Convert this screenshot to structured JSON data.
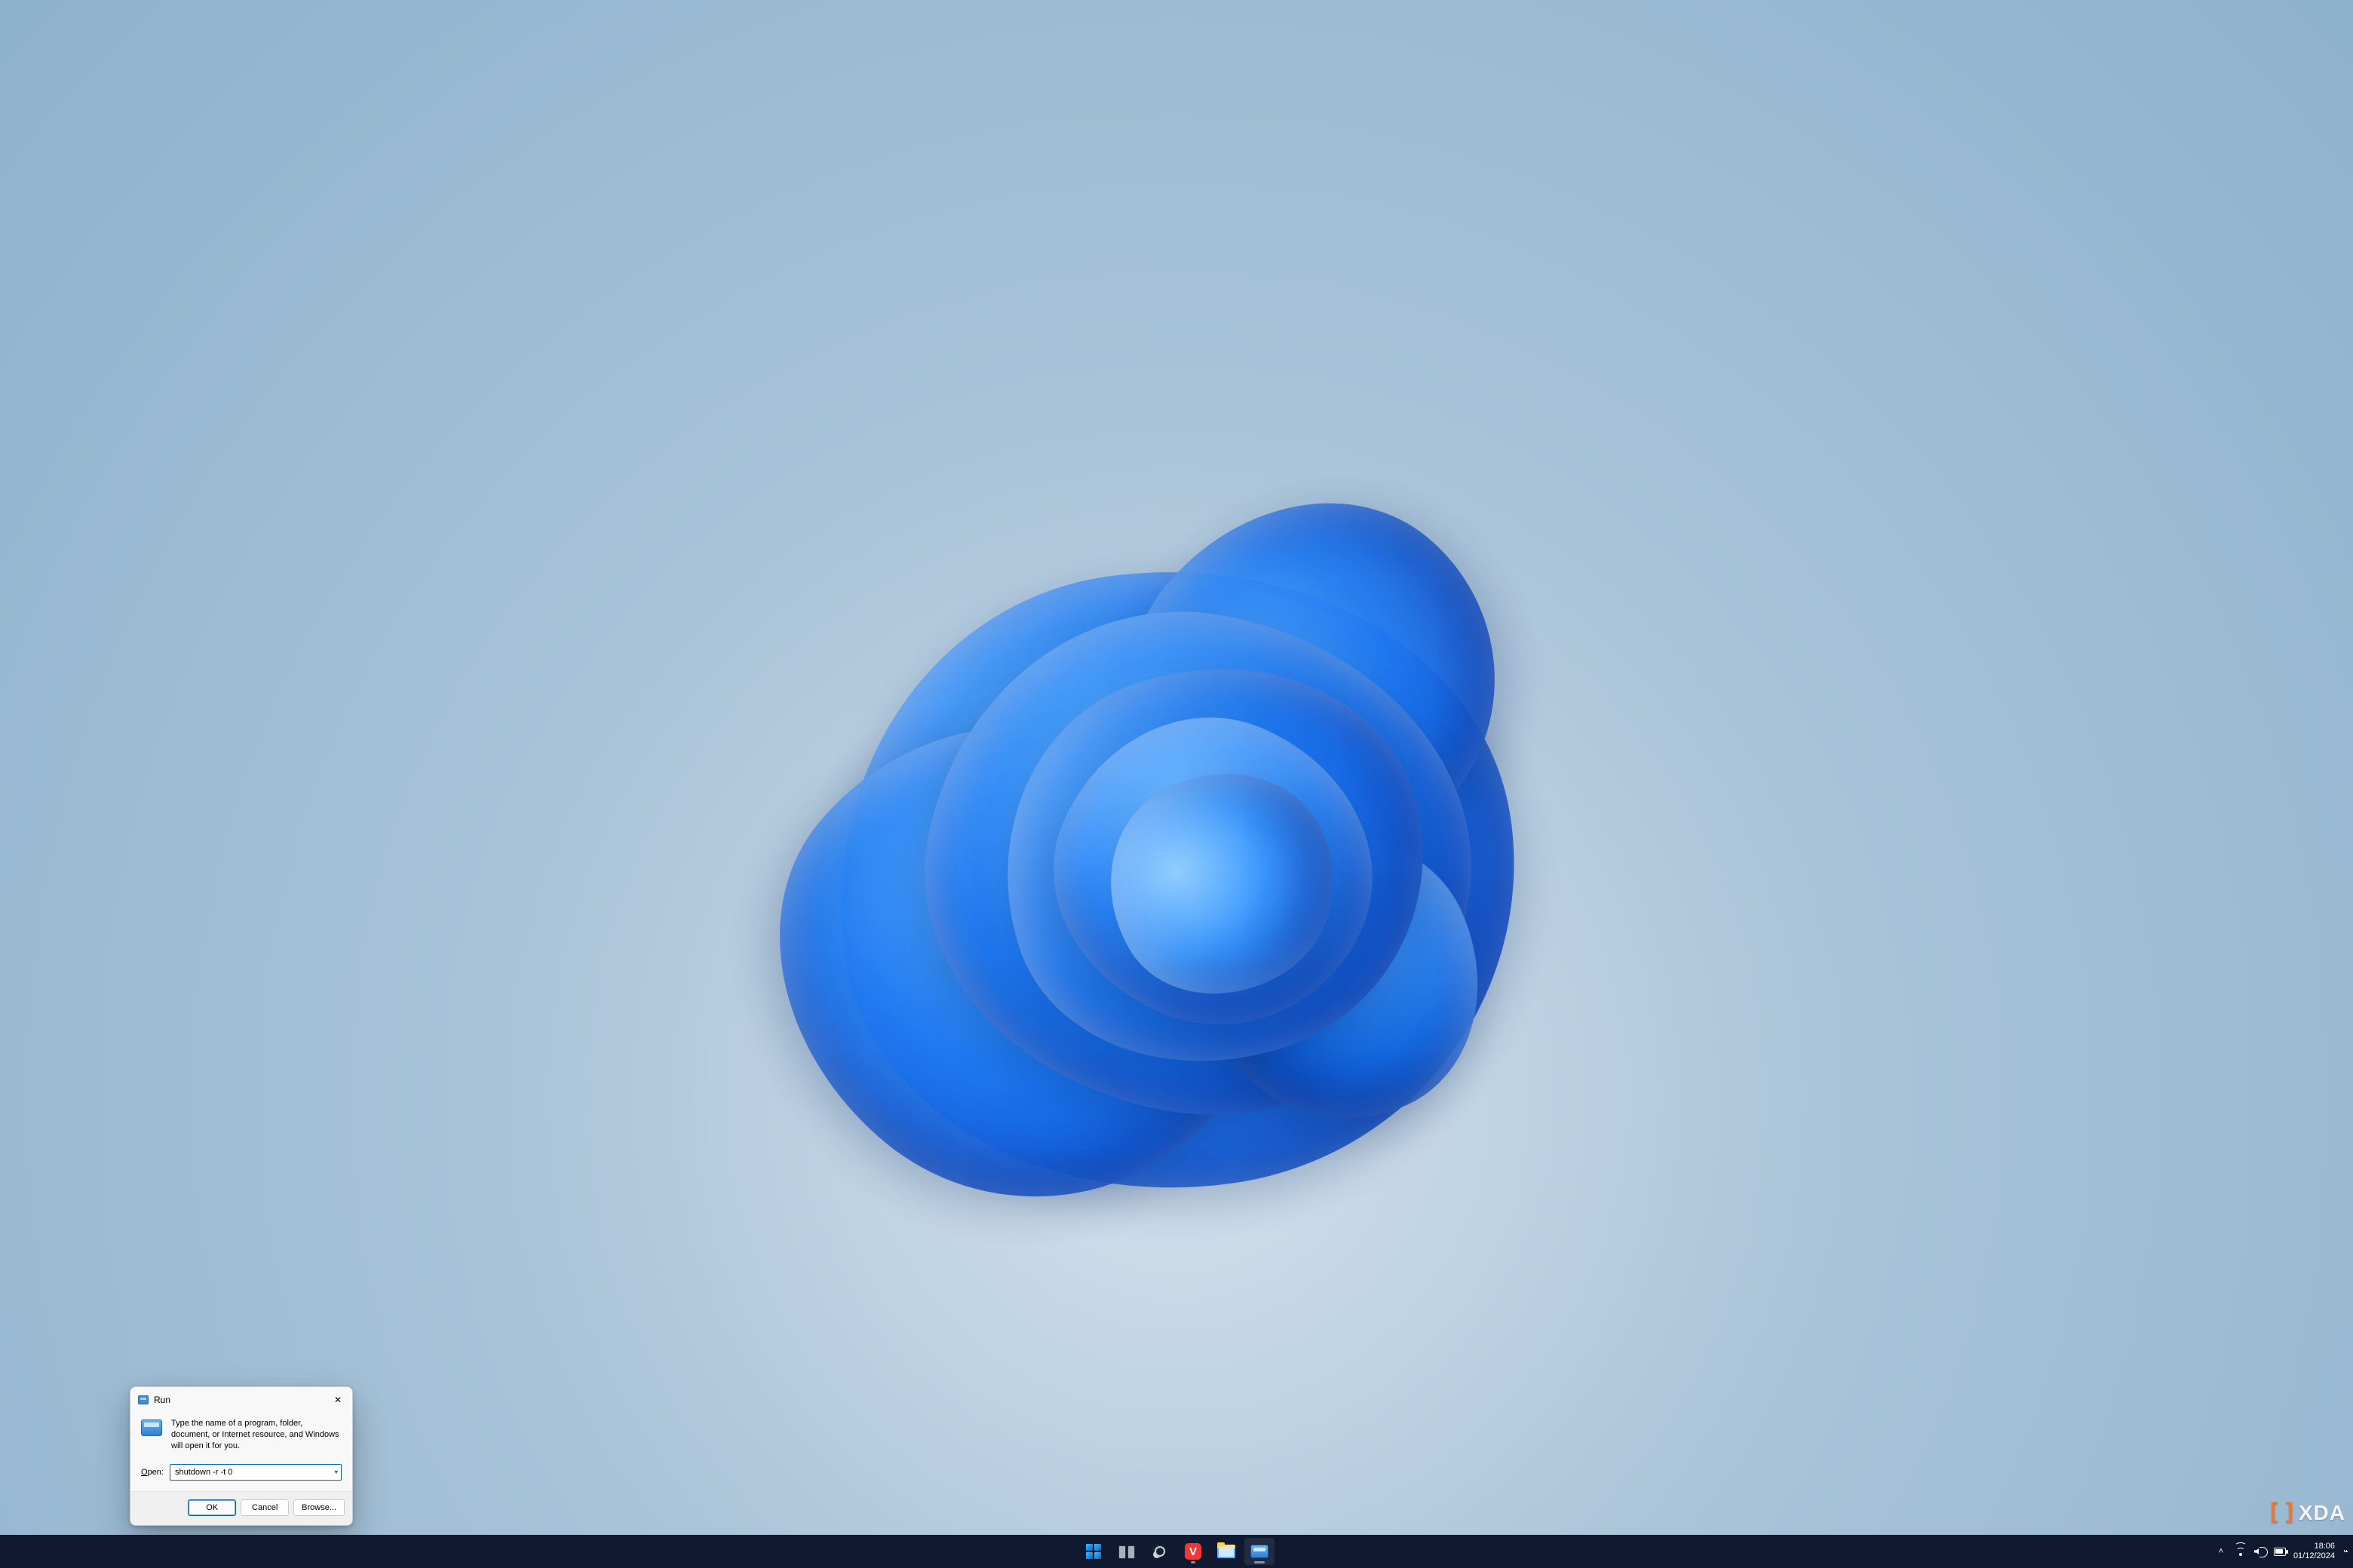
{
  "watermark": {
    "text": "XDA"
  },
  "run_dialog": {
    "title": "Run",
    "description": "Type the name of a program, folder, document, or Internet resource, and Windows will open it for you.",
    "open_label": "Open:",
    "open_value": "shutdown -r -t 0",
    "buttons": {
      "ok": "OK",
      "cancel": "Cancel",
      "browse": "Browse..."
    }
  },
  "taskbar": {
    "items": [
      {
        "name": "start",
        "tooltip": "Start"
      },
      {
        "name": "task-view",
        "tooltip": "Task view"
      },
      {
        "name": "steam",
        "tooltip": "Steam"
      },
      {
        "name": "vivaldi",
        "tooltip": "Vivaldi",
        "glyph": "V"
      },
      {
        "name": "file-explorer",
        "tooltip": "File Explorer"
      },
      {
        "name": "run-app",
        "tooltip": "Run"
      }
    ],
    "tray": {
      "time": "18:06",
      "date": "01/12/2024"
    }
  }
}
